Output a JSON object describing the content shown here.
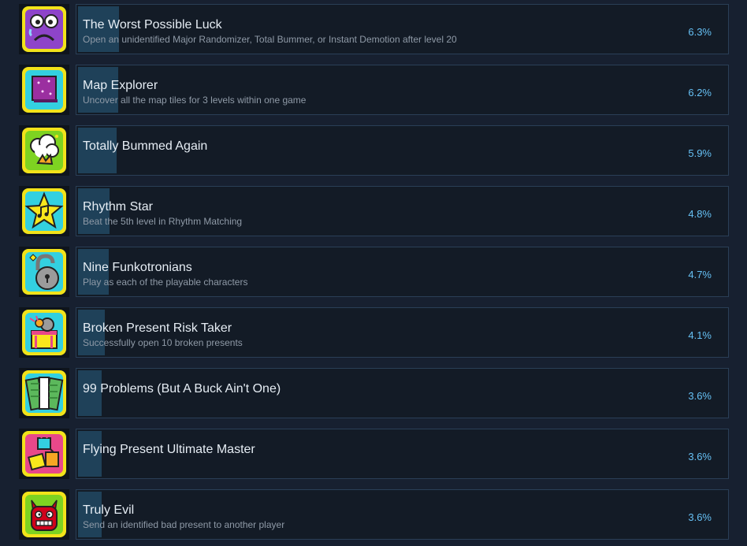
{
  "achievements": [
    {
      "title": "The Worst Possible Luck",
      "description": "Open an unidentified Major Randomizer, Total Bummer, or Instant Demotion after level 20",
      "percent": "6.3%",
      "progress": 0.063,
      "icon": "sad-face-icon"
    },
    {
      "title": "Map Explorer",
      "description": "Uncover all the map tiles for 3 levels within one game",
      "percent": "6.2%",
      "progress": 0.062,
      "icon": "map-tile-icon"
    },
    {
      "title": "Totally Bummed Again",
      "description": "",
      "percent": "5.9%",
      "progress": 0.059,
      "icon": "explosion-cloud-icon"
    },
    {
      "title": "Rhythm Star",
      "description": "Beat the 5th level in Rhythm Matching",
      "percent": "4.8%",
      "progress": 0.048,
      "icon": "music-star-icon"
    },
    {
      "title": "Nine Funkotronians",
      "description": "Play as each of the playable characters",
      "percent": "4.7%",
      "progress": 0.047,
      "icon": "padlock-icon"
    },
    {
      "title": "Broken Present Risk Taker",
      "description": "Successfully open 10 broken presents",
      "percent": "4.1%",
      "progress": 0.041,
      "icon": "broken-present-icon"
    },
    {
      "title": "99 Problems (But A Buck Ain't One)",
      "description": "",
      "percent": "3.6%",
      "progress": 0.036,
      "icon": "money-stack-icon"
    },
    {
      "title": "Flying Present Ultimate Master",
      "description": "",
      "percent": "3.6%",
      "progress": 0.036,
      "icon": "flying-present-icon"
    },
    {
      "title": "Truly Evil",
      "description": "Send an identified bad present to another player",
      "percent": "3.6%",
      "progress": 0.036,
      "icon": "red-devil-icon"
    }
  ],
  "colors": {
    "background": "#172030",
    "card": "#131b26",
    "card_border": "#2a3f57",
    "progress": "#1f4159",
    "title": "#e6edf4",
    "description": "#8f9aa7",
    "percent": "#66c0f4"
  }
}
